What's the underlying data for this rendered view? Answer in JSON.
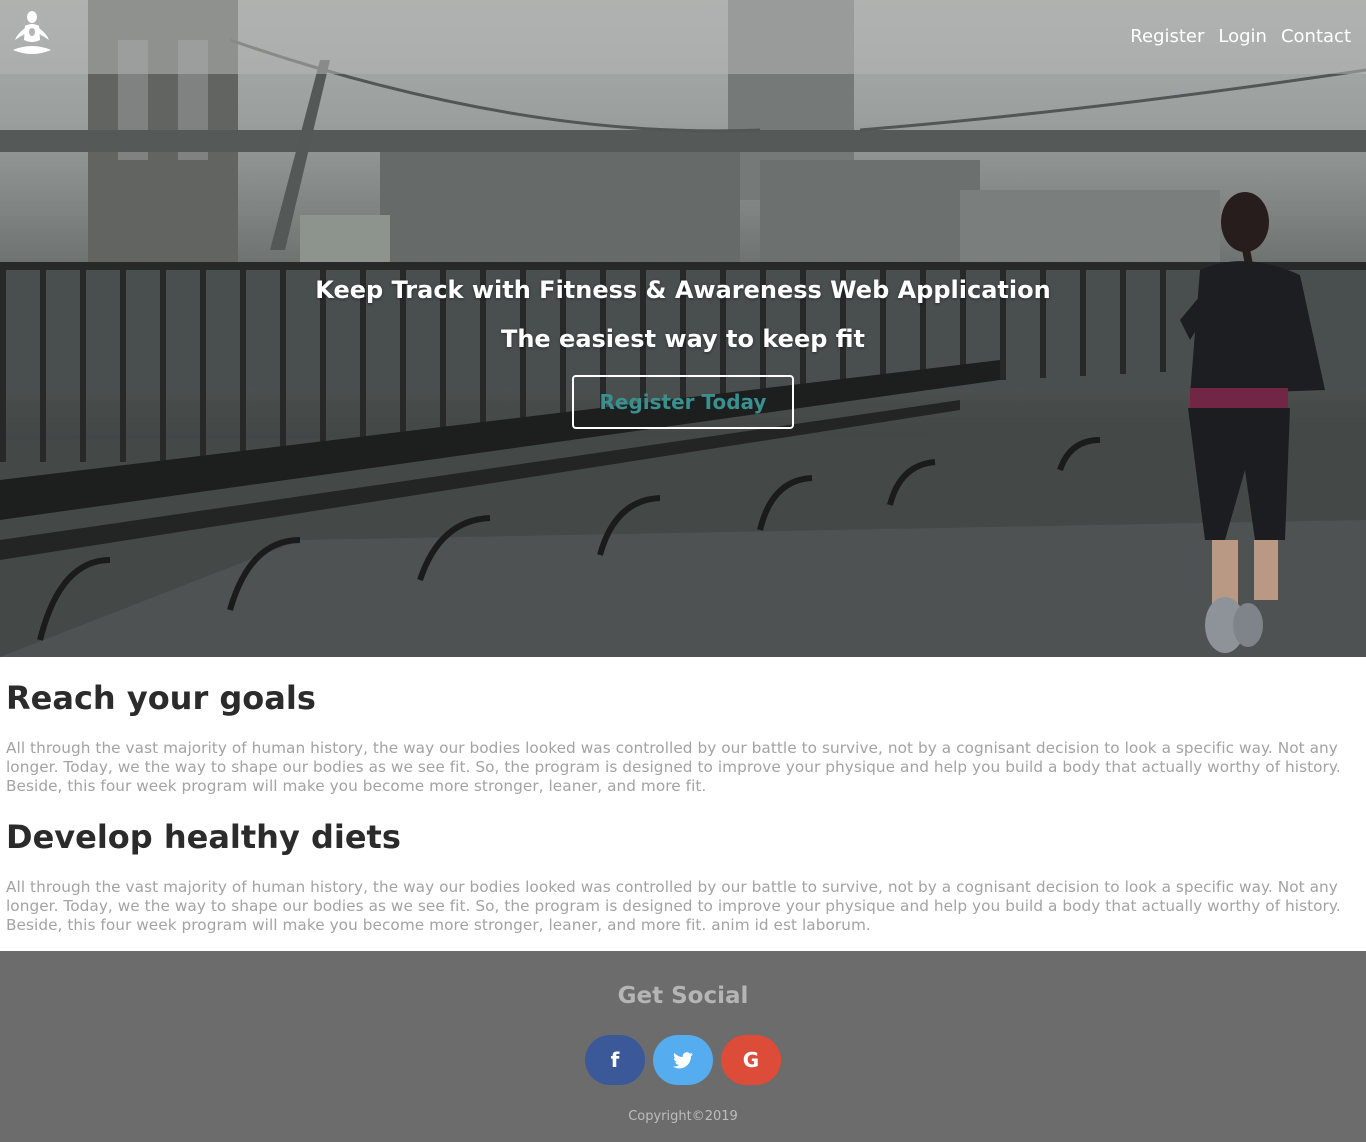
{
  "nav": {
    "logo_icon": "meditation-figure-icon",
    "items": [
      "Register",
      "Login",
      "Contact"
    ]
  },
  "hero": {
    "title": "Keep Track with Fitness & Awareness Web Application",
    "subtitle": "The easiest way to keep fit",
    "cta_label": "Register Today",
    "cta_color": "#3a8f8f"
  },
  "sections": [
    {
      "heading": "Reach your goals",
      "body": "All through the vast majority of human history, the way our bodies looked was controlled by our battle to survive, not by a cognisant decision to look a specific way. Not any longer. Today, we the way to shape our bodies as we see fit. So, the program is designed to improve your physique and help you build a body that actually worthy of history. Beside, this four week program will make you become more stronger, leaner, and more fit."
    },
    {
      "heading": "Develop healthy diets",
      "body": "All through the vast majority of human history, the way our bodies looked was controlled by our battle to survive, not by a cognisant decision to look a specific way. Not any longer. Today, we the way to shape our bodies as we see fit. So, the program is designed to improve your physique and help you build a body that actually worthy of history. Beside, this four week program will make you become more stronger, leaner, and more fit. anim id est laborum."
    }
  ],
  "footer": {
    "title": "Get Social",
    "socials": [
      {
        "glyph": "f",
        "icon": "facebook-icon",
        "color": "#3b5998"
      },
      {
        "glyph": "t",
        "icon": "twitter-icon",
        "color": "#55acee"
      },
      {
        "glyph": "G",
        "icon": "google-icon",
        "color": "#dd4b39"
      }
    ],
    "copyright": "Copyright©2019"
  }
}
